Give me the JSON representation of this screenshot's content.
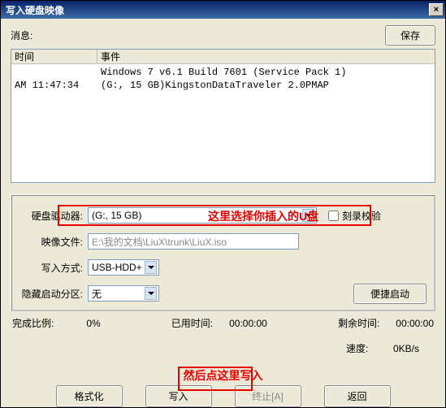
{
  "title": "写入硬盘映像",
  "close_icon": "×",
  "message_label": "消息:",
  "save_label": "保存",
  "log": {
    "col_time": "时间",
    "col_event": "事件",
    "rows": [
      {
        "time": "",
        "event": "Windows 7 v6.1 Build 7601 (Service Pack 1)"
      },
      {
        "time": "AM 11:47:34",
        "event": "(G:, 15 GB)KingstonDataTraveler 2.0PMAP"
      }
    ]
  },
  "fields": {
    "disk_label": "硬盘驱动器:",
    "disk_value": "(G:, 15 GB)",
    "disk_annotation": "这里选择你插入的U盘",
    "verify_label": "刻录校验",
    "image_label": "映像文件:",
    "image_value": "E:\\我的文档\\LiuX\\trunk\\LiuX.iso",
    "method_label": "写入方式:",
    "method_value": "USB-HDD+",
    "hidden_label": "隐藏启动分区:",
    "hidden_value": "无",
    "portable_boot": "便捷启动"
  },
  "progress": {
    "percent_label": "完成比例:",
    "percent_value": "0%",
    "elapsed_label": "已用时间:",
    "elapsed_value": "00:00:00",
    "remain_label": "剩余时间:",
    "remain_value": "00:00:00"
  },
  "speed": {
    "label": "速度:",
    "value": "0KB/s"
  },
  "write_annotation": "然后点这里写入",
  "buttons": {
    "format": "格式化",
    "write": "写入",
    "abort": "终止[A]",
    "back": "返回"
  }
}
